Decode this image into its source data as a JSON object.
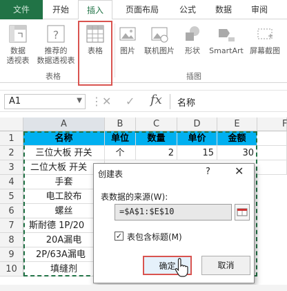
{
  "ribbon_tabs": {
    "file": "文件",
    "home": "开始",
    "insert": "插入",
    "page_layout": "页面布局",
    "formulas": "公式",
    "data": "数据",
    "review": "审阅"
  },
  "ribbon": {
    "pivot_table": "数据\n透视表",
    "recommended_pivot": "推荐的\n数据透视表",
    "table": "表格",
    "pictures": "图片",
    "online_pictures": "联机图片",
    "shapes": "形状",
    "smartart": "SmartArt",
    "screenshot": "屏幕截图",
    "group_tables": "表格",
    "group_illustrations": "插图"
  },
  "formula_bar": {
    "name_box": "A1",
    "content": "名称",
    "fx": "fx"
  },
  "columns": [
    "A",
    "B",
    "C",
    "D",
    "E",
    "F"
  ],
  "rows": [
    "1",
    "2",
    "3",
    "4",
    "5",
    "6",
    "7",
    "8",
    "9",
    "10"
  ],
  "table": {
    "headers": [
      "名称",
      "单位",
      "数量",
      "单价",
      "金额"
    ],
    "names": [
      "三位大板 开关",
      "二位大板 开关",
      "手套",
      "电工胶布",
      "螺丝",
      "斯耐德 1P/20",
      "20A漏电",
      "2P/63A漏电",
      "填缝剂"
    ],
    "row2": {
      "unit": "个",
      "qty": "2",
      "price": "15",
      "amount": "30"
    }
  },
  "dialog": {
    "title": "创建表",
    "help": "?",
    "close": "✕",
    "source_label": "表数据的来源(W):",
    "source_value": "=$A$1:$E$10",
    "checkbox_label": "表包含标题(M)",
    "checked": true,
    "ok": "确定",
    "cancel": "取消"
  },
  "colors": {
    "excel_green": "#217346",
    "header_fill": "#00b0f0",
    "highlight_red": "#d9534f"
  }
}
